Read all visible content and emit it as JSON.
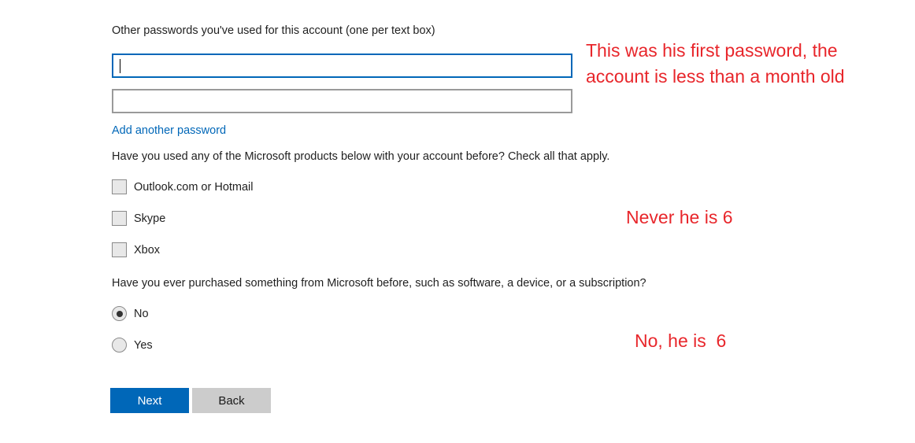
{
  "form": {
    "passwords_label": "Other passwords you've used for this account (one per text box)",
    "password_inputs": [
      {
        "value": "",
        "placeholder": ""
      },
      {
        "value": "",
        "placeholder": ""
      }
    ],
    "add_password_link": "Add another password",
    "products_question": "Have you used any of the Microsoft products below with your account before? Check all that apply.",
    "products": [
      {
        "label": "Outlook.com or Hotmail",
        "checked": false
      },
      {
        "label": "Skype",
        "checked": false
      },
      {
        "label": "Xbox",
        "checked": false
      }
    ],
    "purchase_question": "Have you ever purchased something from Microsoft before, such as software, a device, or a subscription?",
    "purchase_options": [
      {
        "label": "No",
        "selected": true
      },
      {
        "label": "Yes",
        "selected": false
      }
    ],
    "next_label": "Next",
    "back_label": "Back"
  },
  "annotations": {
    "first_password_line1": "This was his first password, the",
    "first_password_line2": "account is less than a month old",
    "products_note": "Never he is 6",
    "purchase_note": "No, he is  6"
  },
  "colors": {
    "accent": "#0067b8",
    "annotation": "#e8262b",
    "secondary_button": "#cccccc"
  }
}
